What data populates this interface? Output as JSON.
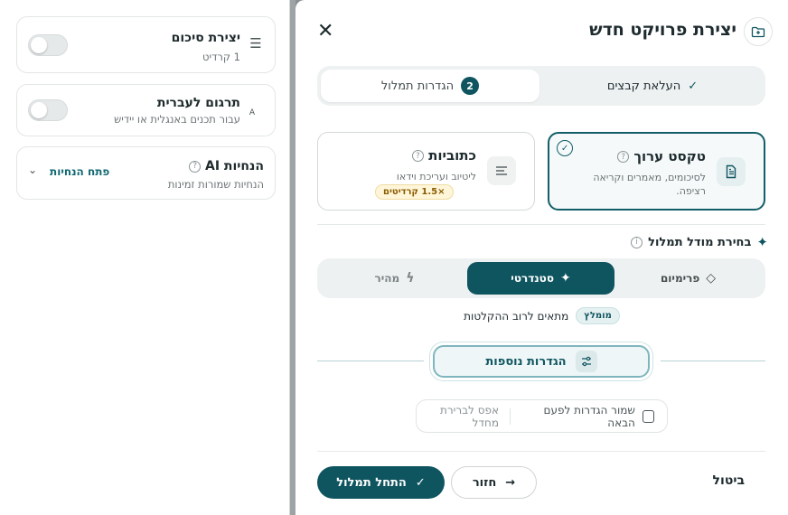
{
  "side_panel": {
    "summary": {
      "title": "יצירת סיכום",
      "subtitle": "1 קרדיט",
      "icon": "list-icon"
    },
    "translate": {
      "title": "תרגום לעברית",
      "subtitle": "עבור תכנים באנגלית או יידיש",
      "icon": "translate-icon"
    },
    "guidelines": {
      "title": "הנחיות AI",
      "subtitle": "הנחיות שמורות זמינות",
      "link": "פתח הנחיות",
      "icon": "info-icon"
    }
  },
  "dialog": {
    "title": "יצירת פרויקט חדש",
    "close": "✕",
    "steps": [
      {
        "label": "העלאת קבצים",
        "state": "done"
      },
      {
        "label": "הגדרות תמלול",
        "number": "2",
        "state": "active"
      }
    ],
    "options": {
      "edited_text": {
        "title": "טקסט ערוך",
        "desc": "לסיכומים, מאמרים וקריאה רציפה.",
        "selected": true
      },
      "captions": {
        "title": "כתוביות",
        "desc": "ליטיוב ועריכת וידאו",
        "badge": "×1.5 קרדיטים",
        "selected": false
      }
    },
    "model_section": {
      "label": "בחירת מודל תמלול",
      "models": [
        {
          "label": "פרימיום",
          "icon": "diamond-icon"
        },
        {
          "label": "סטנדרטי",
          "icon": "sparkle-icon",
          "selected": true
        },
        {
          "label": "מהיר",
          "icon": "bolt-icon"
        }
      ],
      "recommended_pill": "מומלץ",
      "recommended_text": "מתאים לרוב ההקלטות"
    },
    "advanced": {
      "label": "הגדרות נוספות",
      "icon": "sliders-icon"
    },
    "save_defaults": {
      "label": "שמור הגדרות לפעם הבאה",
      "reset": "אפס לברירת מחדל",
      "checked": false
    },
    "footer": {
      "start": "התחל תמלול",
      "back": "חזור",
      "cancel": "ביטול"
    }
  },
  "colors": {
    "primary": "#0f5560",
    "accent_border": "#135e68"
  }
}
